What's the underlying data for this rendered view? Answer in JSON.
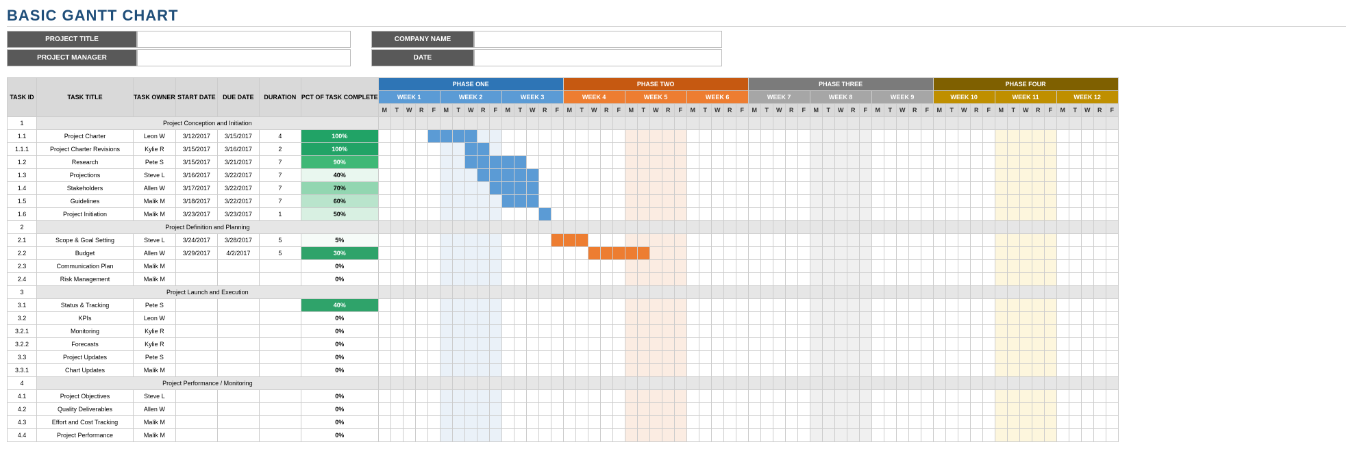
{
  "title": "BASIC GANTT CHART",
  "info_labels": {
    "project_title": "PROJECT TITLE",
    "company_name": "COMPANY NAME",
    "project_manager": "PROJECT MANAGER",
    "date": "DATE"
  },
  "columns": {
    "task_id": "TASK ID",
    "task_title": "TASK TITLE",
    "task_owner": "TASK OWNER",
    "start_date": "START DATE",
    "due_date": "DUE  DATE",
    "duration": "DURATION",
    "pct": "PCT OF TASK COMPLETE"
  },
  "phases": [
    {
      "name": "PHASE ONE",
      "cls": "p1",
      "weeks": [
        {
          "name": "WEEK 1",
          "cls": "w1",
          "shade": ""
        },
        {
          "name": "WEEK 2",
          "cls": "w1",
          "shade": "sh1"
        },
        {
          "name": "WEEK 3",
          "cls": "w1",
          "shade": ""
        }
      ]
    },
    {
      "name": "PHASE TWO",
      "cls": "p2",
      "weeks": [
        {
          "name": "WEEK 4",
          "cls": "w2",
          "shade": ""
        },
        {
          "name": "WEEK 5",
          "cls": "w2",
          "shade": "sh2"
        },
        {
          "name": "WEEK 6",
          "cls": "w2",
          "shade": ""
        }
      ]
    },
    {
      "name": "PHASE THREE",
      "cls": "p3",
      "weeks": [
        {
          "name": "WEEK 7",
          "cls": "w3",
          "shade": ""
        },
        {
          "name": "WEEK 8",
          "cls": "w3",
          "shade": "sh3"
        },
        {
          "name": "WEEK 9",
          "cls": "w3",
          "shade": ""
        }
      ]
    },
    {
      "name": "PHASE FOUR",
      "cls": "p4",
      "weeks": [
        {
          "name": "WEEK 10",
          "cls": "w4",
          "shade": ""
        },
        {
          "name": "WEEK 11",
          "cls": "w4",
          "shade": "sh4"
        },
        {
          "name": "WEEK 12",
          "cls": "w4",
          "shade": ""
        }
      ]
    }
  ],
  "days": [
    "M",
    "T",
    "W",
    "R",
    "F"
  ],
  "rows": [
    {
      "id": "1",
      "title": "Project Conception and Initiation",
      "section": true
    },
    {
      "id": "1.1",
      "title": "Project Charter",
      "owner": "Leon W",
      "start": "3/12/2017",
      "due": "3/15/2017",
      "dur": "4",
      "pct": "100%",
      "pctcls": "pc100",
      "bar": {
        "start": 5,
        "end": 8,
        "cls": "bar1"
      }
    },
    {
      "id": "1.1.1",
      "title": "Project Charter Revisions",
      "owner": "Kylie R",
      "start": "3/15/2017",
      "due": "3/16/2017",
      "dur": "2",
      "pct": "100%",
      "pctcls": "pc100",
      "bar": {
        "start": 8,
        "end": 9,
        "cls": "bar1"
      }
    },
    {
      "id": "1.2",
      "title": "Research",
      "owner": "Pete S",
      "start": "3/15/2017",
      "due": "3/21/2017",
      "dur": "7",
      "pct": "90%",
      "pctcls": "pc90",
      "bar": {
        "start": 8,
        "end": 12,
        "cls": "bar1"
      }
    },
    {
      "id": "1.3",
      "title": "Projections",
      "owner": "Steve L",
      "start": "3/16/2017",
      "due": "3/22/2017",
      "dur": "7",
      "pct": "40%",
      "pctcls": "pc40",
      "bar": {
        "start": 9,
        "end": 13,
        "cls": "bar1"
      }
    },
    {
      "id": "1.4",
      "title": "Stakeholders",
      "owner": "Allen W",
      "start": "3/17/2017",
      "due": "3/22/2017",
      "dur": "7",
      "pct": "70%",
      "pctcls": "pc70",
      "bar": {
        "start": 10,
        "end": 13,
        "cls": "bar1"
      }
    },
    {
      "id": "1.5",
      "title": "Guidelines",
      "owner": "Malik M",
      "start": "3/18/2017",
      "due": "3/22/2017",
      "dur": "7",
      "pct": "60%",
      "pctcls": "pc60",
      "bar": {
        "start": 11,
        "end": 13,
        "cls": "bar1"
      }
    },
    {
      "id": "1.6",
      "title": "Project Initiation",
      "owner": "Malik M",
      "start": "3/23/2017",
      "due": "3/23/2017",
      "dur": "1",
      "pct": "50%",
      "pctcls": "pc50",
      "bar": {
        "start": 14,
        "end": 14,
        "cls": "bar1"
      }
    },
    {
      "id": "2",
      "title": "Project Definition and Planning",
      "section": true
    },
    {
      "id": "2.1",
      "title": "Scope & Goal Setting",
      "owner": "Steve L",
      "start": "3/24/2017",
      "due": "3/28/2017",
      "dur": "5",
      "pct": "5%",
      "pctcls": "pclow",
      "bar": {
        "start": 15,
        "end": 17,
        "cls": "bar2"
      }
    },
    {
      "id": "2.2",
      "title": "Budget",
      "owner": "Allen W",
      "start": "3/29/2017",
      "due": "4/2/2017",
      "dur": "5",
      "pct": "30%",
      "pctcls": "pc30",
      "bar": {
        "start": 18,
        "end": 22,
        "cls": "bar2"
      }
    },
    {
      "id": "2.3",
      "title": "Communication Plan",
      "owner": "Malik M",
      "start": "",
      "due": "",
      "dur": "",
      "pct": "0%",
      "pctcls": "pc0"
    },
    {
      "id": "2.4",
      "title": "Risk Management",
      "owner": "Malik M",
      "start": "",
      "due": "",
      "dur": "",
      "pct": "0%",
      "pctcls": "pc0"
    },
    {
      "id": "3",
      "title": "Project Launch and Execution",
      "section": true
    },
    {
      "id": "3.1",
      "title": "Status & Tracking",
      "owner": "Pete S",
      "start": "",
      "due": "",
      "dur": "",
      "pct": "40%",
      "pctcls": "pc30"
    },
    {
      "id": "3.2",
      "title": "KPIs",
      "owner": "Leon W",
      "start": "",
      "due": "",
      "dur": "",
      "pct": "0%",
      "pctcls": "pc0"
    },
    {
      "id": "3.2.1",
      "title": "Monitoring",
      "owner": "Kylie R",
      "start": "",
      "due": "",
      "dur": "",
      "pct": "0%",
      "pctcls": "pc0"
    },
    {
      "id": "3.2.2",
      "title": "Forecasts",
      "owner": "Kylie R",
      "start": "",
      "due": "",
      "dur": "",
      "pct": "0%",
      "pctcls": "pc0"
    },
    {
      "id": "3.3",
      "title": "Project Updates",
      "owner": "Pete S",
      "start": "",
      "due": "",
      "dur": "",
      "pct": "0%",
      "pctcls": "pc0"
    },
    {
      "id": "3.3.1",
      "title": "Chart Updates",
      "owner": "Malik M",
      "start": "",
      "due": "",
      "dur": "",
      "pct": "0%",
      "pctcls": "pc0"
    },
    {
      "id": "4",
      "title": "Project Performance / Monitoring",
      "section": true
    },
    {
      "id": "4.1",
      "title": "Project Objectives",
      "owner": "Steve L",
      "start": "",
      "due": "",
      "dur": "",
      "pct": "0%",
      "pctcls": "pc0"
    },
    {
      "id": "4.2",
      "title": "Quality Deliverables",
      "owner": "Allen W",
      "start": "",
      "due": "",
      "dur": "",
      "pct": "0%",
      "pctcls": "pc0"
    },
    {
      "id": "4.3",
      "title": "Effort and Cost Tracking",
      "owner": "Malik M",
      "start": "",
      "due": "",
      "dur": "",
      "pct": "0%",
      "pctcls": "pc0"
    },
    {
      "id": "4.4",
      "title": "Project Performance",
      "owner": "Malik M",
      "start": "",
      "due": "",
      "dur": "",
      "pct": "0%",
      "pctcls": "pc0"
    }
  ],
  "chart_data": {
    "type": "table",
    "title": "Basic Gantt Chart",
    "x_axis": "Weeks 1–12 (M T W R F)",
    "series": [
      {
        "task": "Project Charter",
        "start_day": 5,
        "end_day": 8,
        "pct": 100
      },
      {
        "task": "Project Charter Revisions",
        "start_day": 8,
        "end_day": 9,
        "pct": 100
      },
      {
        "task": "Research",
        "start_day": 8,
        "end_day": 12,
        "pct": 90
      },
      {
        "task": "Projections",
        "start_day": 9,
        "end_day": 13,
        "pct": 40
      },
      {
        "task": "Stakeholders",
        "start_day": 10,
        "end_day": 13,
        "pct": 70
      },
      {
        "task": "Guidelines",
        "start_day": 11,
        "end_day": 13,
        "pct": 60
      },
      {
        "task": "Project Initiation",
        "start_day": 14,
        "end_day": 14,
        "pct": 50
      },
      {
        "task": "Scope & Goal Setting",
        "start_day": 15,
        "end_day": 17,
        "pct": 5
      },
      {
        "task": "Budget",
        "start_day": 18,
        "end_day": 22,
        "pct": 30
      }
    ]
  }
}
